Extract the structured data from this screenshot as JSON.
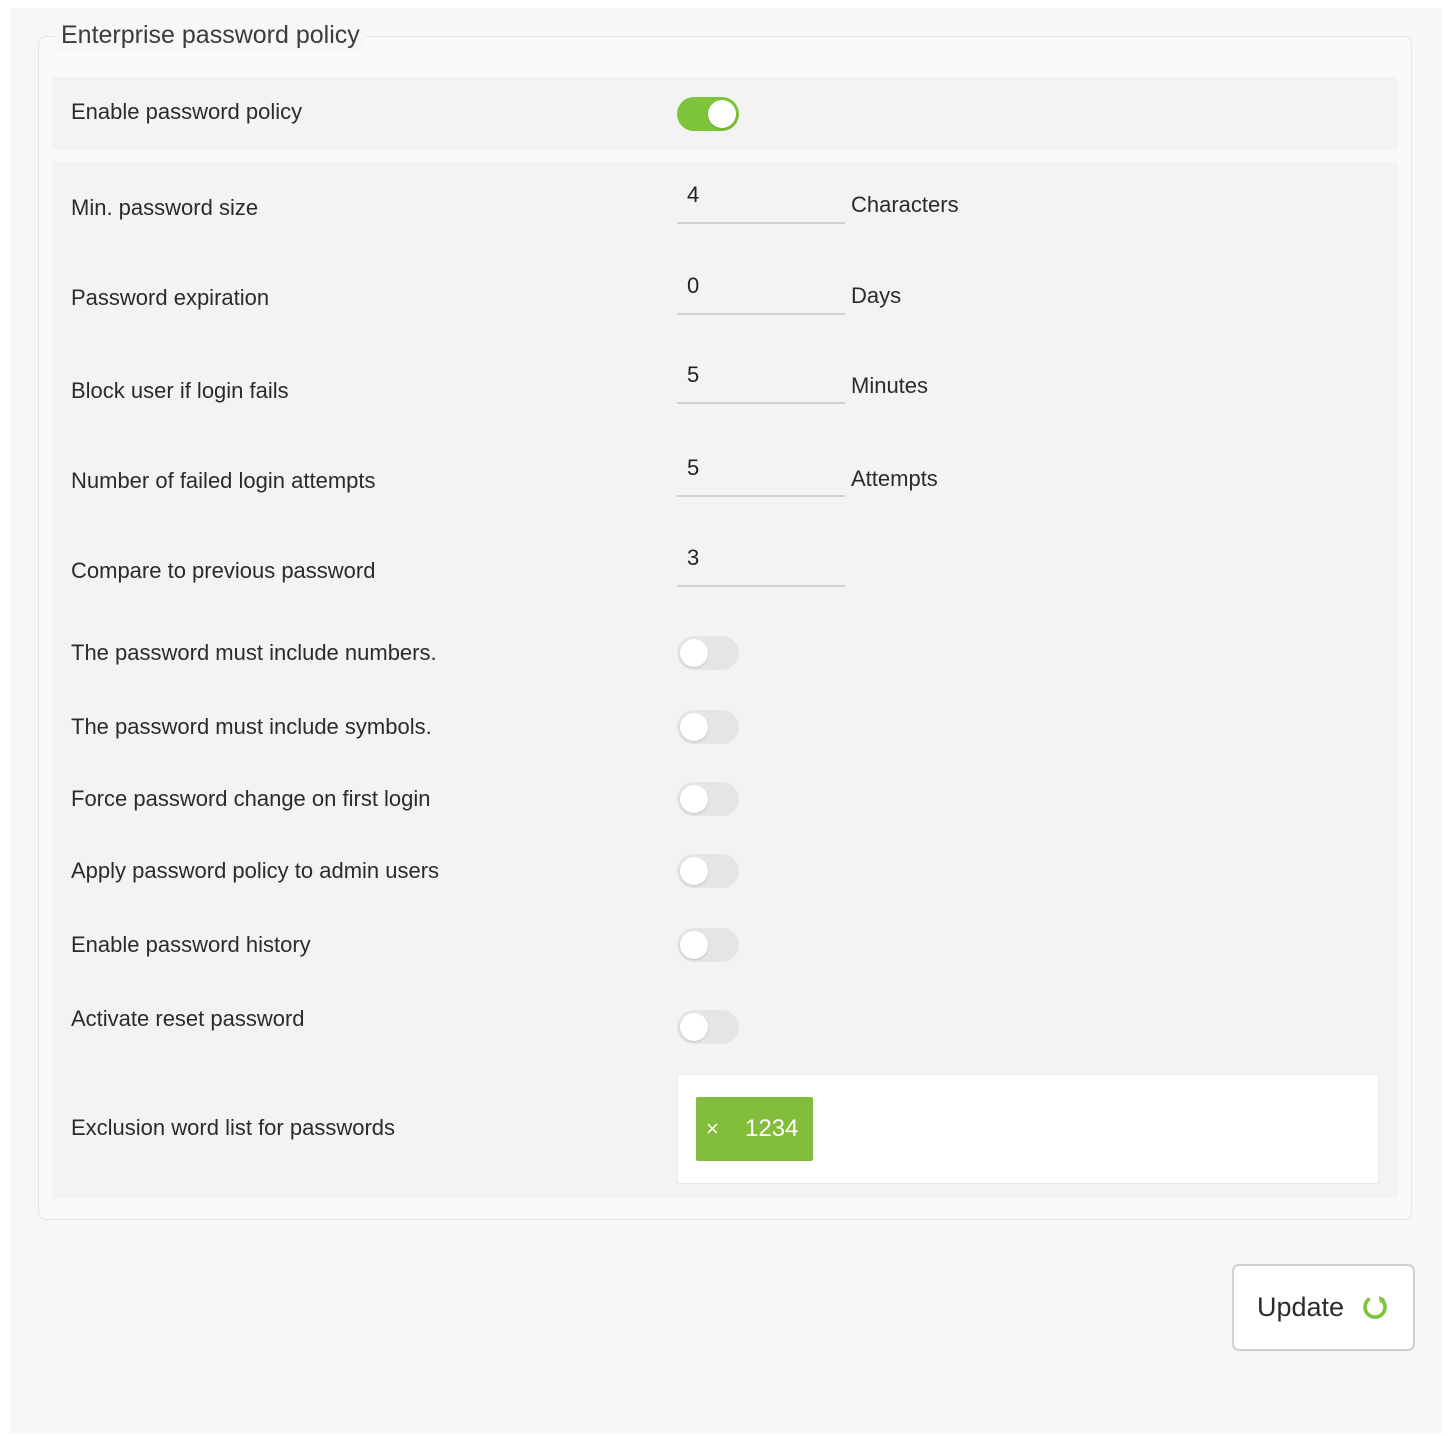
{
  "policy": {
    "legend": "Enterprise password policy",
    "enable": {
      "label": "Enable password policy",
      "on": true
    },
    "fields": [
      {
        "label": "Min. password size",
        "value": "4",
        "unit": "Characters"
      },
      {
        "label": "Password expiration",
        "value": "0",
        "unit": "Days"
      },
      {
        "label": "Block user if login fails",
        "value": "5",
        "unit": "Minutes"
      },
      {
        "label": "Number of failed login attempts",
        "value": "5",
        "unit": "Attempts"
      },
      {
        "label": "Compare to previous password",
        "value": "3",
        "unit": ""
      }
    ],
    "toggles": [
      {
        "label": "The password must include numbers.",
        "on": false
      },
      {
        "label": "The password must include symbols.",
        "on": false
      },
      {
        "label": "Force password change on first login",
        "on": false
      },
      {
        "label": "Apply password policy to admin users",
        "on": false
      },
      {
        "label": "Enable password history",
        "on": false
      },
      {
        "label": "Activate reset password",
        "on": false
      }
    ],
    "exclusion": {
      "label": "Exclusion word list for passwords",
      "tags": [
        {
          "remove": "×",
          "value": "1234"
        }
      ]
    }
  },
  "update_button": {
    "label": "Update",
    "icon": "refresh-icon"
  },
  "colors": {
    "accent_green": "#7ec43a",
    "tag_green": "#82be3c"
  }
}
